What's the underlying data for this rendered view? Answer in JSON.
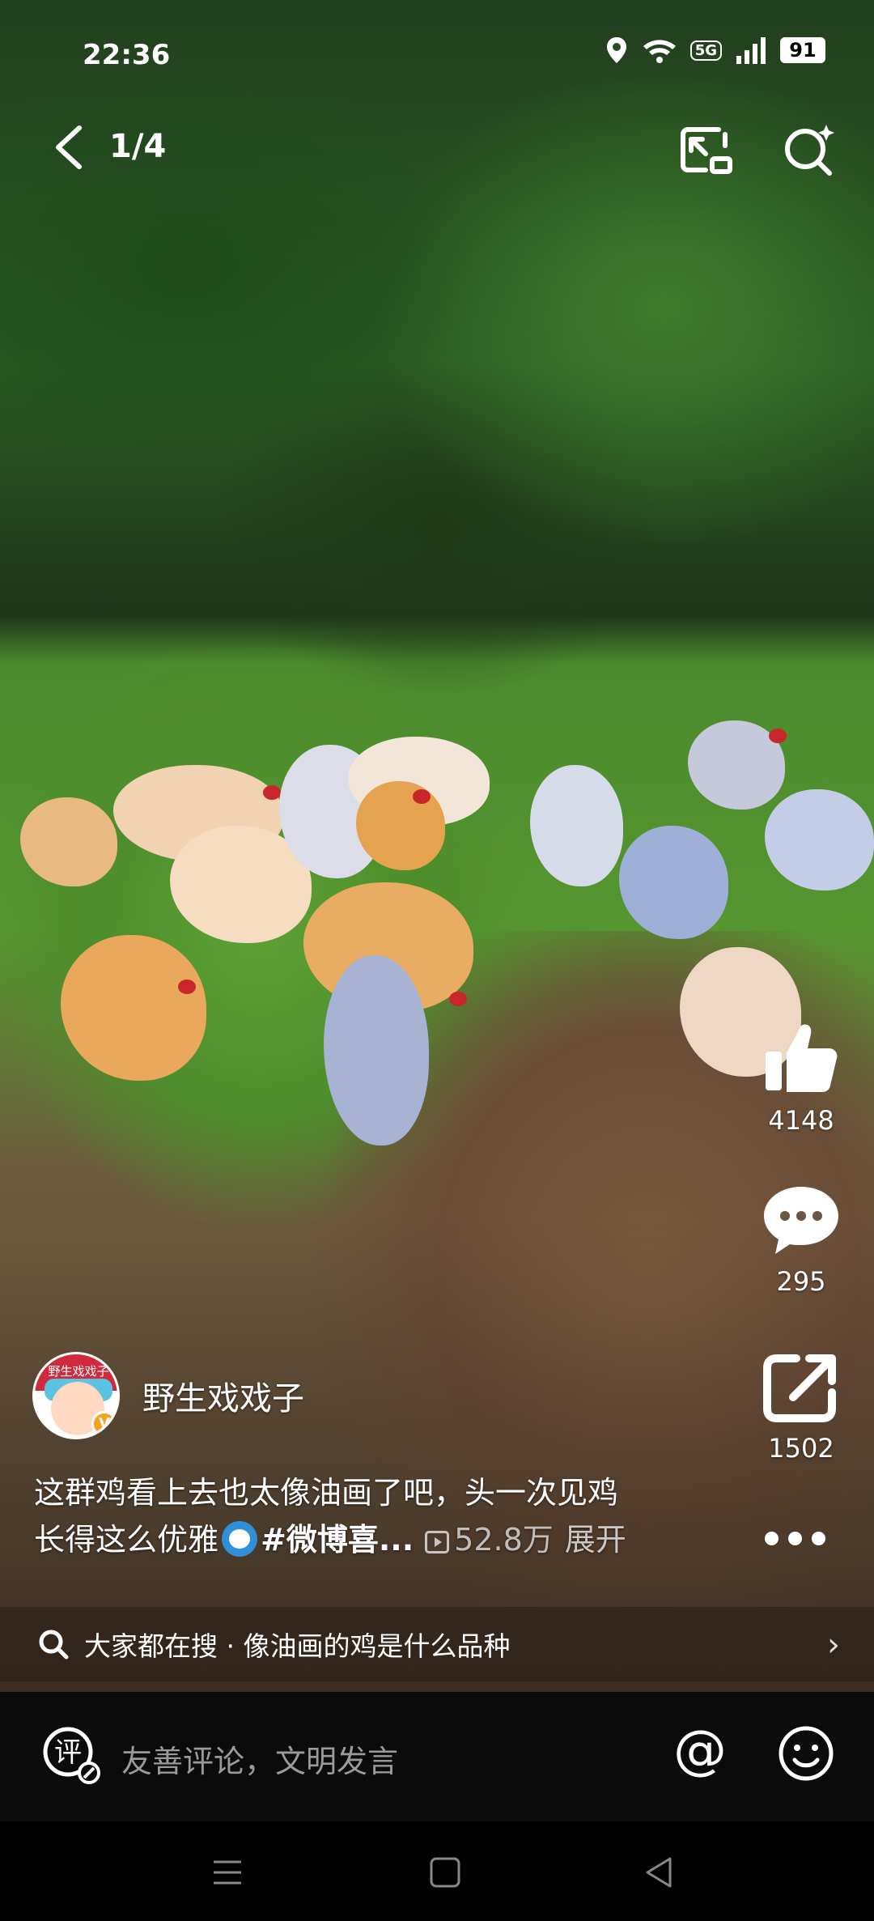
{
  "status_bar": {
    "time": "22:36",
    "network": "5G",
    "battery": "91",
    "icons": [
      "location-icon",
      "wifi-icon",
      "signal-icon",
      "battery-icon"
    ]
  },
  "top_bar": {
    "page_counter": "1/4",
    "icons": [
      "back-arrow-icon",
      "picture-in-picture-icon",
      "search-sparkle-icon"
    ]
  },
  "actions": {
    "like_count": "4148",
    "comment_count": "295",
    "share_count": "1502"
  },
  "author": {
    "name": "野生戏戏子",
    "avatar_text": "野生戏戏子",
    "verified_mark": "V"
  },
  "post": {
    "caption_line1": "这群鸡看上去也太像油画了吧，头一次见鸡",
    "caption_line2": "长得这么优雅",
    "hashtag": "#微博喜...",
    "views": "52.8万",
    "expand_label": "展开"
  },
  "search_suggestion": {
    "text": "大家都在搜 · 像油画的鸡是什么品种",
    "chevron": "›"
  },
  "comment_bar": {
    "comment_icon_char": "评",
    "placeholder": "友善评论，文明发言",
    "at_char": "@"
  },
  "colors": {
    "background": "#000000",
    "comment_bar": "#0b0b0b",
    "placeholder": "#9a9a9a",
    "verified": "#f6a21e"
  }
}
